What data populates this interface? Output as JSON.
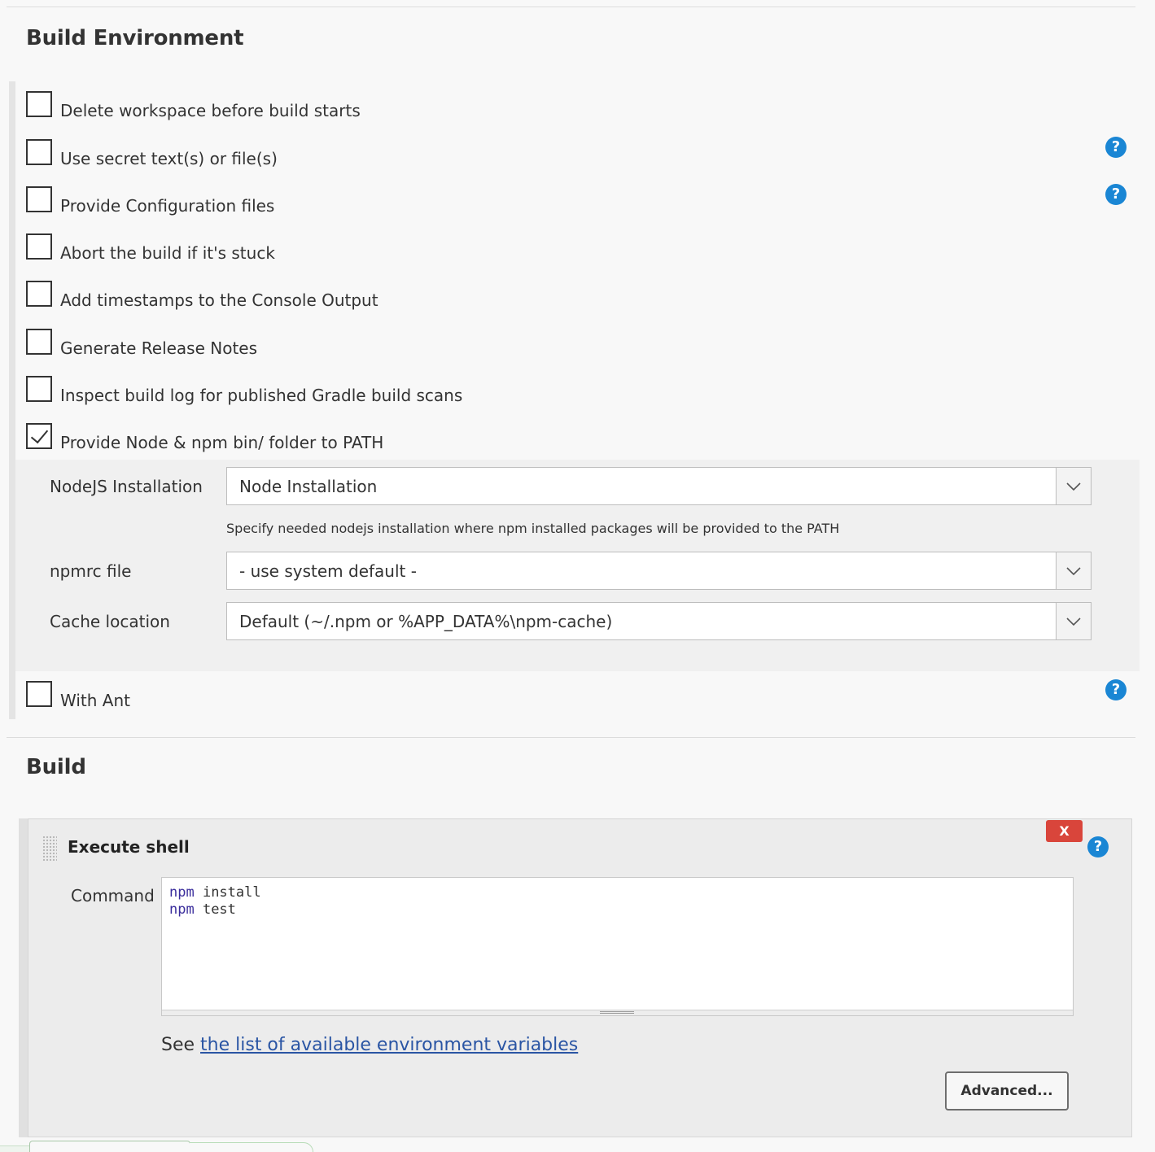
{
  "build_environment": {
    "title": "Build Environment",
    "options": [
      {
        "label": "Delete workspace before build starts",
        "checked": false,
        "help": false
      },
      {
        "label": "Use secret text(s) or file(s)",
        "checked": false,
        "help": true
      },
      {
        "label": "Provide Configuration files",
        "checked": false,
        "help": true
      },
      {
        "label": "Abort the build if it's stuck",
        "checked": false,
        "help": false
      },
      {
        "label": "Add timestamps to the Console Output",
        "checked": false,
        "help": false
      },
      {
        "label": "Generate Release Notes",
        "checked": false,
        "help": false
      },
      {
        "label": "Inspect build log for published Gradle build scans",
        "checked": false,
        "help": false
      },
      {
        "label": "Provide Node & npm bin/ folder to PATH",
        "checked": true,
        "help": false
      },
      {
        "label": "With Ant",
        "checked": false,
        "help": true
      }
    ],
    "node": {
      "installation_label": "NodeJS Installation",
      "installation_value": "Node Installation",
      "installation_hint": "Specify needed nodejs installation where npm installed packages will be provided to the PATH",
      "npmrc_label": "npmrc file",
      "npmrc_value": "- use system default -",
      "cache_label": "Cache location",
      "cache_value": "Default (~/.npm or %APP_DATA%\\npm-cache)"
    }
  },
  "build": {
    "title": "Build",
    "step": {
      "title": "Execute shell",
      "delete_label": "X",
      "command_label": "Command",
      "command_lines": [
        {
          "cmd": "npm",
          "arg": " install"
        },
        {
          "cmd": "npm",
          "arg": " test"
        }
      ],
      "see_prefix": "See ",
      "see_link": "the list of available environment variables",
      "advanced_label": "Advanced..."
    }
  },
  "help_glyph": "?",
  "colors": {
    "help": "#1a86d4",
    "delete": "#d9453b",
    "link": "#2a55a4",
    "keyword": "#3a2d9c"
  }
}
